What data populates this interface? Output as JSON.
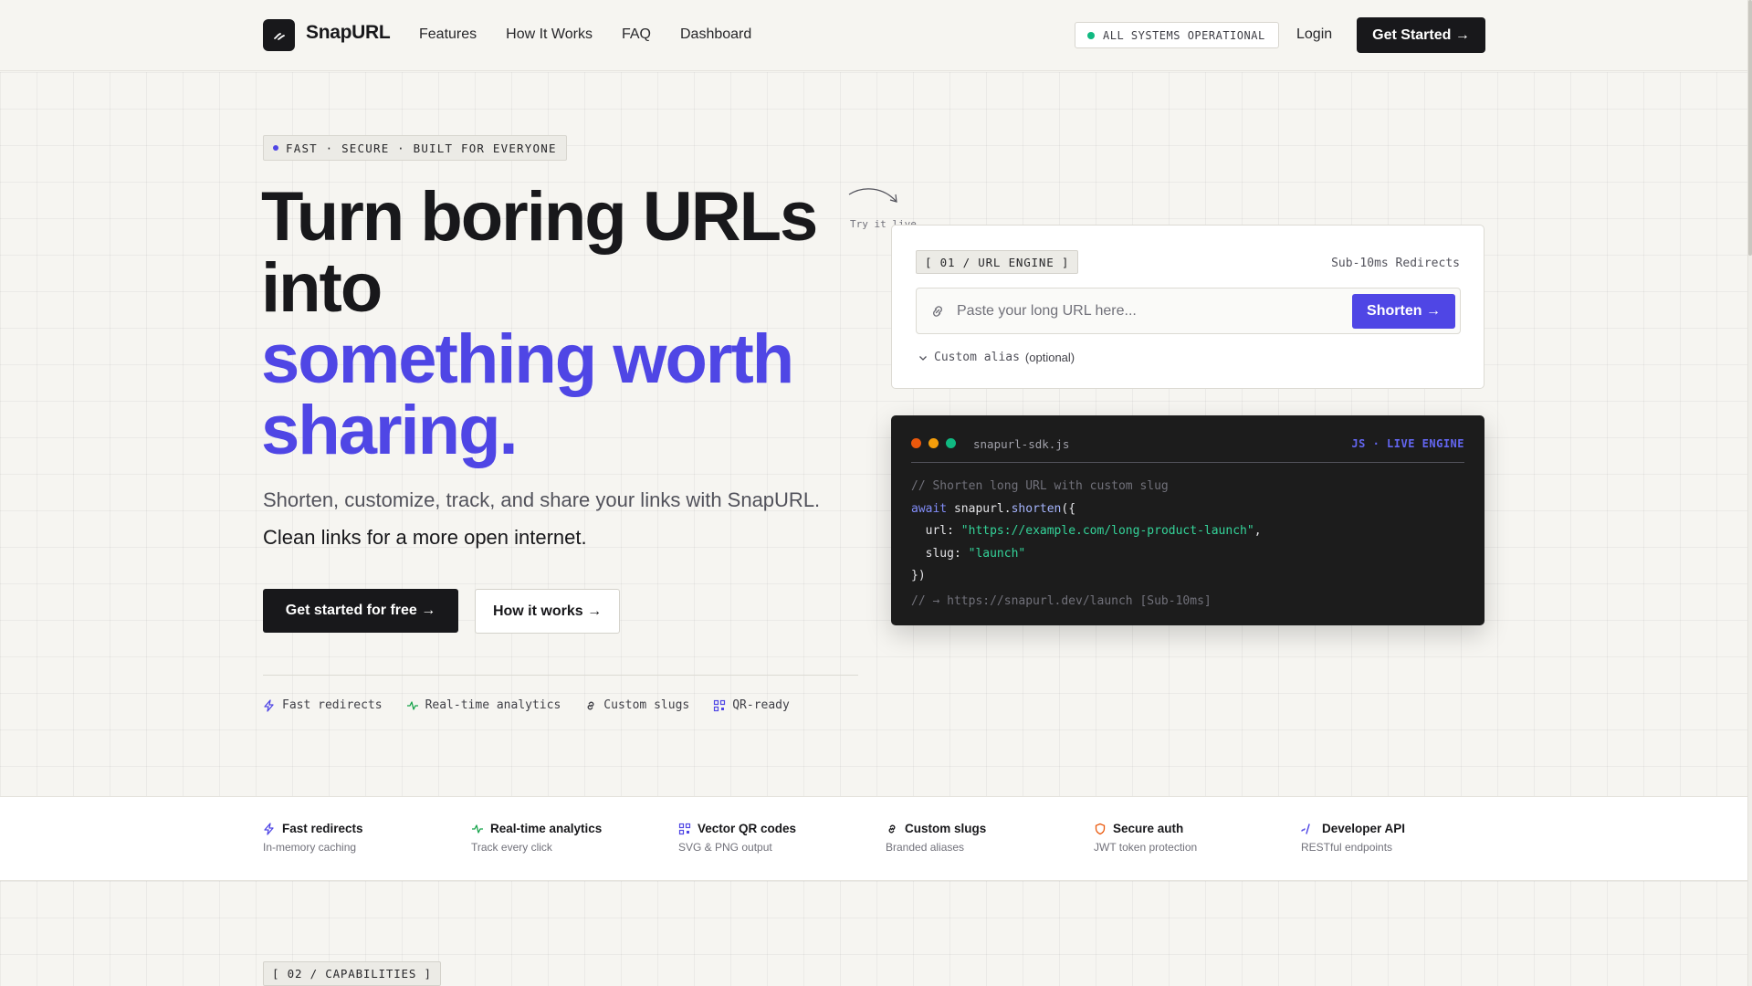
{
  "nav": {
    "brand": "SnapURL",
    "links": [
      "Features",
      "How It Works",
      "FAQ",
      "Dashboard"
    ],
    "status": "ALL SYSTEMS OPERATIONAL",
    "login": "Login",
    "cta": "Get Started →"
  },
  "hero": {
    "eyebrow": "FAST · SECURE · BUILT FOR EVERYONE",
    "headline_line1": "Turn boring URLs",
    "headline_line2": "into",
    "headline_accent1": "something worth",
    "headline_accent2": "sharing.",
    "subtitle": "Shorten, customize, track, and share your links with SnapURL.",
    "tagline": "Clean links for a more open internet.",
    "primary_button": "Get started for free →",
    "secondary_button": "How it works →",
    "mini_features": [
      "Fast redirects",
      "Real-time analytics",
      "Custom slugs",
      "QR-ready"
    ],
    "try_live": "Try it live"
  },
  "url_card": {
    "tag": "[ 01 / URL ENGINE ]",
    "redirects": "Sub-10ms Redirects",
    "input_placeholder": "Paste your long URL here...",
    "shorten_button": "Shorten →",
    "alias_label": "Custom alias",
    "alias_optional": "(optional)"
  },
  "code_card": {
    "filename": "snapurl-sdk.js",
    "badge": "JS · LIVE ENGINE",
    "comment1": "// Shorten long URL with custom slug",
    "kw_await": "await",
    "obj": " snapurl.",
    "fn": "shorten",
    "open": "({",
    "url_key": "  url: ",
    "url_val": "\"https://example.com/long-product-launch\"",
    "url_comma": ",",
    "slug_key": "  slug: ",
    "slug_val": "\"launch\"",
    "close": "})",
    "result": "// → https://snapurl.dev/launch [Sub-10ms]"
  },
  "strip": [
    {
      "title": "Fast redirects",
      "sub": "In-memory caching",
      "icon": "bolt-icon"
    },
    {
      "title": "Real-time analytics",
      "sub": "Track every click",
      "icon": "pulse-icon"
    },
    {
      "title": "Vector QR codes",
      "sub": "SVG & PNG output",
      "icon": "qr-icon"
    },
    {
      "title": "Custom slugs",
      "sub": "Branded aliases",
      "icon": "link-icon"
    },
    {
      "title": "Secure auth",
      "sub": "JWT token protection",
      "icon": "shield-icon"
    },
    {
      "title": "Developer API",
      "sub": "RESTful endpoints",
      "icon": "code-icon"
    }
  ],
  "capabilities_tag": "[ 02 / CAPABILITIES ]",
  "colors": {
    "accent": "#4f46e5",
    "dark": "#18181b",
    "background": "#f6f5f1",
    "status_green": "#10b981",
    "dot_red": "#ea580c",
    "dot_amber": "#f59e0b",
    "dot_green": "#10b981"
  }
}
